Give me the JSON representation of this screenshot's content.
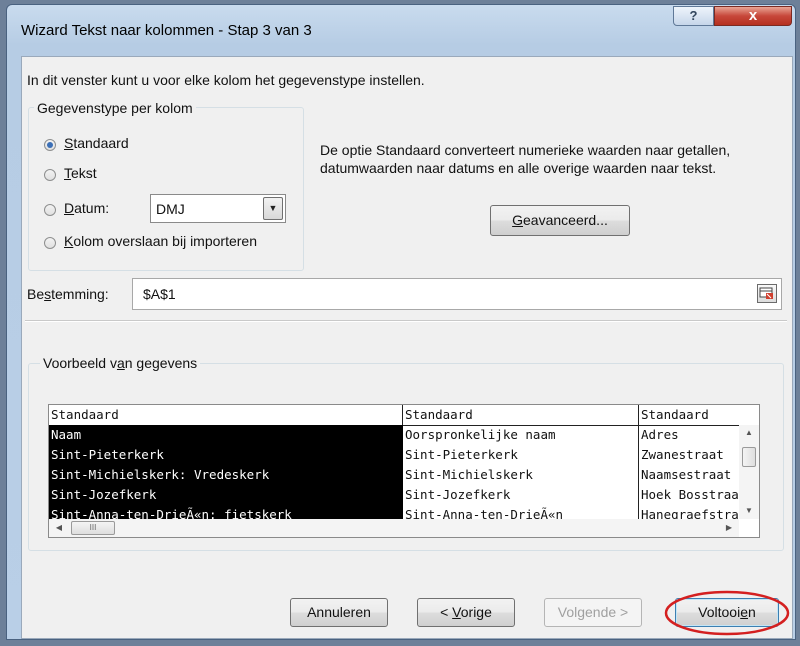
{
  "window": {
    "title": "Wizard Tekst naar kolommen - Stap 3 van 3",
    "help_glyph": "?",
    "close_glyph": "x"
  },
  "intro": "In dit venster kunt u voor elke kolom het gegevenstype instellen.",
  "column_format": {
    "legend": "Gegevenstype per kolom",
    "options": [
      {
        "pre": "",
        "key": "S",
        "post": "tandaard",
        "selected": true
      },
      {
        "pre": "",
        "key": "T",
        "post": "ekst",
        "selected": false
      },
      {
        "pre": "",
        "key": "D",
        "post": "atum:",
        "selected": false
      },
      {
        "pre": "",
        "key": "K",
        "post": "olom overslaan bij importeren",
        "selected": false
      }
    ],
    "date_format": "DMJ",
    "dropdown_glyph": "▼"
  },
  "description": "De optie Standaard converteert numerieke waarden naar getallen, datumwaarden naar datums en alle overige waarden naar tekst.",
  "advanced_button": {
    "pre": "",
    "key": "G",
    "post": "eavanceerd..."
  },
  "destination": {
    "label_pre": "Be",
    "label_key": "s",
    "label_post": "temming:",
    "value": "$A$1"
  },
  "preview": {
    "legend_pre": "Voorbeeld v",
    "legend_key": "a",
    "legend_post": "n gegevens",
    "headers": [
      "Standaard",
      "Standaard",
      "Standaard"
    ],
    "rows": [
      [
        "Naam",
        "Oorspronkelijke naam",
        "Adres"
      ],
      [
        "Sint-Pieterkerk",
        "Sint-Pieterkerk",
        "Zwanestraat"
      ],
      [
        "Sint-Michielskerk: Vredeskerk",
        "Sint-Michielskerk",
        "Naamsestraat"
      ],
      [
        "Sint-Jozefkerk",
        "Sint-Jozefkerk",
        "Hoek Bosstraat"
      ],
      [
        "Sint-Anna-ten-DrieÃ«n: fietskerk",
        "Sint-Anna-ten-DrieÃ«n",
        "Hanegraefstraat"
      ]
    ],
    "scroll_up": "▲",
    "scroll_down": "▼",
    "scroll_left": "◀",
    "scroll_right": "▶",
    "grip": "III"
  },
  "buttons": {
    "cancel": "Annuleren",
    "back": {
      "pre": "< ",
      "key": "V",
      "post": "orige"
    },
    "next": "Volgende >",
    "finish": {
      "pre": "Voltooi",
      "key": "e",
      "post": "n"
    }
  },
  "colors": {
    "highlight_ring": "#d42020",
    "radio_dot": "#3b6fb6",
    "selected_column_bg": "#000000"
  }
}
